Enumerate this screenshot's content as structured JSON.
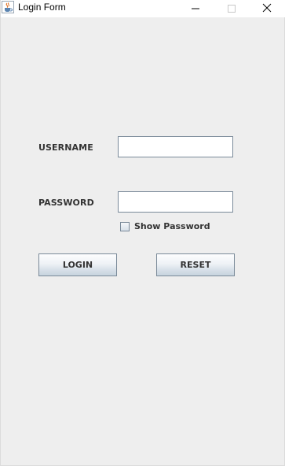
{
  "window": {
    "title": "Login Form",
    "icon": "java-cup-icon",
    "controls": {
      "minimize_icon": "minimize-icon",
      "maximize_icon": "maximize-icon",
      "close_icon": "close-icon"
    }
  },
  "form": {
    "username_label": "USERNAME",
    "username_value": "",
    "password_label": "PASSWORD",
    "password_value": "",
    "show_password_label": "Show Password",
    "show_password_checked": false,
    "login_label": "LOGIN",
    "reset_label": "RESET"
  },
  "colors": {
    "background": "#eeeeee",
    "label_text": "#333333",
    "border": "#7a8a99"
  }
}
